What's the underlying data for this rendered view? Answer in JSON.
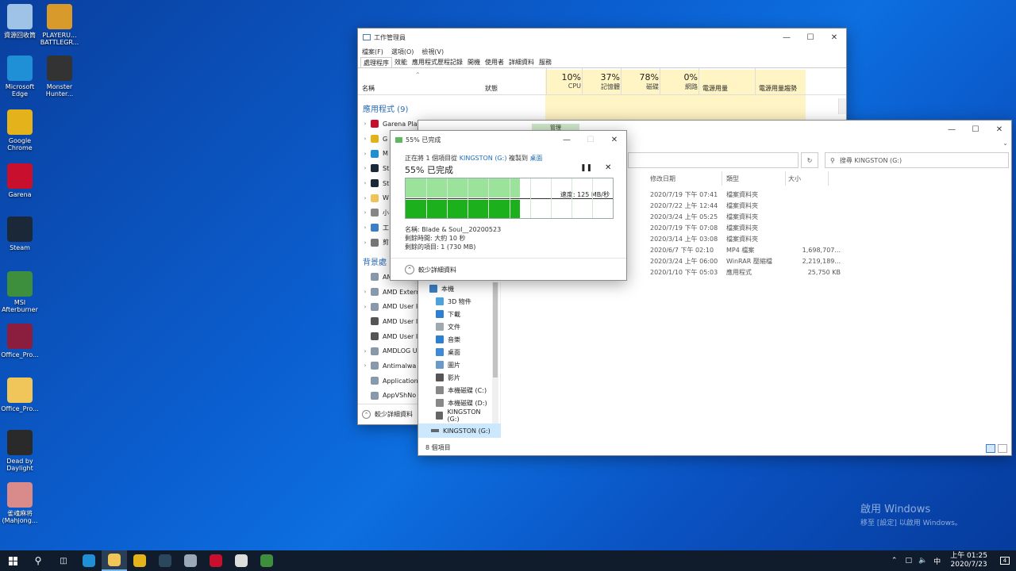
{
  "desktop": {
    "icons": [
      {
        "label": "資源回收筒",
        "icon": "recycle-bin-icon",
        "color": "#9fc3e6"
      },
      {
        "label": "PLAYERU... BATTLEGR...",
        "icon": "pubg-icon",
        "color": "#d89a2a"
      },
      {
        "label": "Microsoft Edge",
        "icon": "edge-icon",
        "color": "#1f8fd6"
      },
      {
        "label": "Monster Hunter...",
        "icon": "monster-hunter-icon",
        "color": "#333333"
      },
      {
        "label": "Google Chrome",
        "icon": "chrome-icon",
        "color": "#e4b21b"
      },
      {
        "label": "Garena",
        "icon": "garena-icon",
        "color": "#c8102e"
      },
      {
        "label": "Steam",
        "icon": "steam-icon",
        "color": "#1b2838"
      },
      {
        "label": "MSI Afterburner",
        "icon": "msi-afterburner-icon",
        "color": "#3d8f3d"
      },
      {
        "label": "Office_Pro...",
        "icon": "winrar-icon",
        "color": "#8b1e3f"
      },
      {
        "label": "Office_Pro...",
        "icon": "folder-icon",
        "color": "#f0c55a"
      },
      {
        "label": "Dead by Daylight",
        "icon": "dead-by-daylight-icon",
        "color": "#2a2a2a"
      },
      {
        "label": "雀魂麻将(Mahjong...",
        "icon": "mahjong-soul-icon",
        "color": "#d98a8a"
      }
    ],
    "watermark_line1": "啟用 Windows",
    "watermark_line2": "移至 [設定] 以啟用 Windows。"
  },
  "task_manager": {
    "title": "工作管理員",
    "menu": [
      "檔案(F)",
      "選項(O)",
      "檢視(V)"
    ],
    "tabs": [
      "處理程序",
      "效能",
      "應用程式歷程記錄",
      "開機",
      "使用者",
      "詳細資料",
      "服務"
    ],
    "columns": {
      "name": "名稱",
      "status": "狀態",
      "cpu_pct": "10%",
      "cpu": "CPU",
      "mem_pct": "37%",
      "mem": "記憶體",
      "disk_pct": "78%",
      "disk": "磁碟",
      "net_pct": "0%",
      "net": "網路",
      "power": "電源用量",
      "power_trend": "電源用量趨勢"
    },
    "section_apps": "應用程式 (9)",
    "apps": [
      {
        "name": "Garena Pla",
        "color": "#c8102e"
      },
      {
        "name": "G",
        "color": "#e4b21b"
      },
      {
        "name": "M",
        "color": "#1f8fd6"
      },
      {
        "name": "St",
        "color": "#1b2838"
      },
      {
        "name": "St",
        "color": "#1b2838"
      },
      {
        "name": "W",
        "color": "#f0c55a"
      },
      {
        "name": "小",
        "color": "#888888"
      },
      {
        "name": "工",
        "color": "#3c7fc7"
      },
      {
        "name": "剪",
        "color": "#777777"
      }
    ],
    "section_bg": "背景處",
    "bg_procs": [
      {
        "name": "AMD",
        "color": "#8899aa",
        "chev": false
      },
      {
        "name": "AMD Extern",
        "color": "#8899aa",
        "chev": true
      },
      {
        "name": "AMD User I",
        "color": "#8899aa",
        "chev": true
      },
      {
        "name": "AMD User I",
        "color": "#555555",
        "chev": false
      },
      {
        "name": "AMD User I",
        "color": "#555555",
        "chev": false
      },
      {
        "name": "AMDLOG U",
        "color": "#8899aa",
        "chev": true
      },
      {
        "name": "Antimalwa",
        "color": "#8899aa",
        "chev": true
      },
      {
        "name": "Application",
        "color": "#8899aa",
        "chev": false
      },
      {
        "name": "AppVShNo",
        "color": "#8899aa",
        "chev": false
      }
    ],
    "fewer_details": "較少詳細資料"
  },
  "explorer": {
    "search_placeholder": "搜尋 KINGSTON (G:)",
    "headers": {
      "date": "修改日期",
      "type": "類型",
      "size": "大小"
    },
    "rows": [
      {
        "date": "2020/7/19 下午 07:41",
        "type": "檔案資料夾",
        "size": ""
      },
      {
        "date": "2020/7/22 上午 12:44",
        "type": "檔案資料夾",
        "size": ""
      },
      {
        "date": "2020/3/24 上午 05:25",
        "type": "檔案資料夾",
        "size": ""
      },
      {
        "date": "2020/7/19 下午 07:08",
        "type": "檔案資料夾",
        "size": ""
      },
      {
        "date": "2020/3/14 上午 03:08",
        "type": "檔案資料夾",
        "size": ""
      },
      {
        "date": "2020/6/7 下午 02:10",
        "type": "MP4 檔案",
        "size": "1,698,707..."
      },
      {
        "date": "2020/3/24 上午 06:00",
        "type": "WinRAR 壓縮檔",
        "size": "2,219,189..."
      },
      {
        "date": "2020/1/10 下午 05:03",
        "type": "應用程式",
        "size": "25,750 KB"
      }
    ],
    "nav": [
      {
        "label": "本機",
        "color": "#3c7fc7",
        "indent": 0
      },
      {
        "label": "3D 物件",
        "color": "#4aa3df",
        "indent": 1
      },
      {
        "label": "下載",
        "color": "#2d7fd3",
        "indent": 1
      },
      {
        "label": "文件",
        "color": "#a0a8b0",
        "indent": 1
      },
      {
        "label": "音樂",
        "color": "#2d7fd3",
        "indent": 1
      },
      {
        "label": "桌面",
        "color": "#3c8ad8",
        "indent": 1
      },
      {
        "label": "圖片",
        "color": "#6a9ac8",
        "indent": 1
      },
      {
        "label": "影片",
        "color": "#555555",
        "indent": 1
      },
      {
        "label": "本機磁碟 (C:)",
        "color": "#888888",
        "indent": 1
      },
      {
        "label": "本機磁碟 (D:)",
        "color": "#888888",
        "indent": 1
      },
      {
        "label": "KINGSTON (G:)",
        "color": "#666666",
        "indent": 1
      }
    ],
    "selected_nav": "KINGSTON (G:)",
    "status": "8 個項目",
    "tab_label": "管理"
  },
  "copy_dialog": {
    "title": "55% 已完成",
    "line1_prefix": "正在將 1 個項目從",
    "line1_src": "KINGSTON (G:)",
    "line1_mid": "複製到",
    "line1_dst": "桌面",
    "progress_title": "55% 已完成",
    "progress_fraction": 0.55,
    "speed": "速度: 125 MB/秒",
    "name": "名稱: Blade & Soul__20200523",
    "remaining_time": "剩餘時間: 大約 10 秒",
    "remaining_items": "剩餘的項目: 1 (730 MB)",
    "fewer_details": "較少詳細資料"
  },
  "taskbar": {
    "apps": [
      {
        "icon": "edge-icon",
        "color": "#1f8fd6"
      },
      {
        "icon": "file-explorer-icon",
        "color": "#f0c55a"
      },
      {
        "icon": "chrome-icon",
        "color": "#e4b21b"
      },
      {
        "icon": "steam-icon",
        "color": "#2a475e"
      },
      {
        "icon": "task-manager-icon",
        "color": "#9aa9b8"
      },
      {
        "icon": "garena-icon",
        "color": "#c8102e"
      },
      {
        "icon": "msi-icon",
        "color": "#dddddd"
      },
      {
        "icon": "msi-afterburner-icon",
        "color": "#3d8f3d"
      }
    ],
    "ime": "中",
    "time": "上午 01:25",
    "date": "2020/7/23",
    "notifications": "4"
  }
}
